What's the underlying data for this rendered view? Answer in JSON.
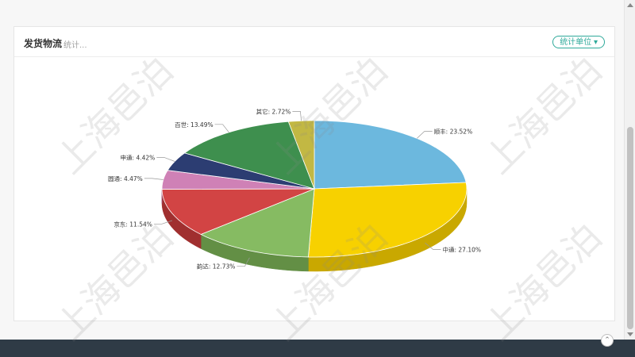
{
  "card": {
    "title": "发货物流",
    "subtitle": "统计...",
    "unit_button": "统计单位 ▾"
  },
  "watermark": "上海邑泊",
  "back_to_top_icon": "arrow-up-circle-icon",
  "colors": {
    "accent": "#2ea99a",
    "footer": "#2f3b46"
  },
  "chart_data": {
    "type": "pie",
    "title": "",
    "three_d": true,
    "slices": [
      {
        "label": "顺丰",
        "value": 23.52,
        "color": "#6cb8de",
        "side": "#4e8fb0",
        "text": "顺丰: 23.52%"
      },
      {
        "label": "中通",
        "value": 27.1,
        "color": "#f7d100",
        "side": "#c9a800",
        "text": "中通: 27.10%"
      },
      {
        "label": "韵达",
        "value": 12.73,
        "color": "#86bb62",
        "side": "#638f45",
        "text": "韵达: 12.73%"
      },
      {
        "label": "京东",
        "value": 11.54,
        "color": "#d24444",
        "side": "#a02f2f",
        "text": "京东: 11.54%"
      },
      {
        "label": "圆通",
        "value": 4.47,
        "color": "#cf81b6",
        "side": "#a0608c",
        "text": "圆通: 4.47%"
      },
      {
        "label": "申通",
        "value": 4.42,
        "color": "#2c3d72",
        "side": "#1c2850",
        "text": "申通: 4.42%"
      },
      {
        "label": "百世",
        "value": 13.49,
        "color": "#3e8f4e",
        "side": "#2c6a38",
        "text": "百世: 13.49%"
      },
      {
        "label": "其它",
        "value": 2.72,
        "color": "#c2b843",
        "side": "#958d2e",
        "text": "其它: 2.72%"
      }
    ]
  }
}
